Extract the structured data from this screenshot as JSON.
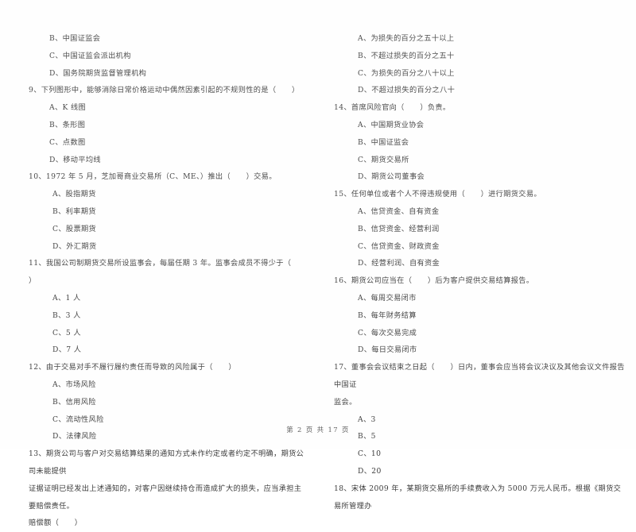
{
  "document": {
    "type": "exam-paper",
    "footer": "第 2 页 共 17 页"
  },
  "left_column": {
    "leading_options": [
      "B、中国证监会",
      "C、中国证监会派出机构",
      "D、国务院期货监督管理机构"
    ],
    "questions": [
      {
        "number": "9",
        "text": "9、下列图形中，能够消除日常价格运动中偶然因素引起的不规则性的是（      ）",
        "options": [
          "A、K 线图",
          "B、条形图",
          "C、点数图",
          "D、移动平均线"
        ]
      },
      {
        "number": "10",
        "text": "10、1972 年 5 月，芝加哥商业交易所（C、ME、）推出（      ）交易。",
        "options": [
          "A、股指期货",
          "B、利率期货",
          "C、股票期货",
          "D、外汇期货"
        ]
      },
      {
        "number": "11",
        "text": "11、我国公司制期货交易所设监事会，每届任期 3 年。监事会成员不得少于（      ）",
        "options": [
          "A、1 人",
          "B、3 人",
          "C、5 人",
          "D、7 人"
        ]
      },
      {
        "number": "12",
        "text": "12、由于交易对手不履行履约责任而导致的风险属于（      ）",
        "options": [
          "A、市场风险",
          "B、信用风险",
          "C、流动性风险",
          "D、法律风险"
        ]
      },
      {
        "number": "13",
        "text": "13、期货公司与客户对交易结算结果的通知方式未作约定或者约定不明确，期货公司未能提供",
        "continuation": [
          "证据证明已经发出上述通知的，对客户因继续持仓而造成扩大的损失，应当承担主要赔偿责任。",
          "赔偿额（      ）"
        ],
        "options": []
      }
    ]
  },
  "right_column": {
    "leading_options": [
      "A、为损失的百分之五十以上",
      "B、不超过损失的百分之五十",
      "C、为损失的百分之八十以上",
      "D、不超过损失的百分之八十"
    ],
    "questions": [
      {
        "number": "14",
        "text": "14、首席风险官向（      ）负责。",
        "options": [
          "A、中国期货业协会",
          "B、中国证监会",
          "C、期货交易所",
          "D、期货公司董事会"
        ]
      },
      {
        "number": "15",
        "text": "15、任何单位或者个人不得违规使用（      ）进行期货交易。",
        "options": [
          "A、信贷资金、自有资金",
          "B、信贷资金、经营利润",
          "C、信贷资金、财政资金",
          "D、经营利润、自有资金"
        ]
      },
      {
        "number": "16",
        "text": "16、期货公司应当在（      ）后为客户提供交易结算报告。",
        "options": [
          "A、每周交易闭市",
          "B、每年财务结算",
          "C、每次交易完成",
          "D、每日交易闭市"
        ]
      },
      {
        "number": "17",
        "text": "17、董事会会议结束之日起（      ）日内，董事会应当将会议决议及其他会议文件报告中国证",
        "continuation": [
          "监会。"
        ],
        "options": [
          "A、3",
          "B、5",
          "C、10",
          "D、20"
        ]
      },
      {
        "number": "18",
        "text": "18、宋体 2009 年，某期货交易所的手续费收入为 5000 万元人民币。根据《期货交易所管理办",
        "options": []
      }
    ]
  }
}
